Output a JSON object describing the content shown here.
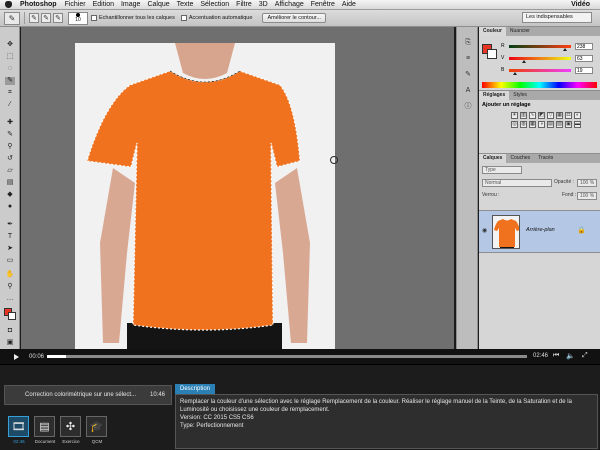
{
  "menubar": {
    "app_name": "Photoshop",
    "items": [
      "Fichier",
      "Edition",
      "Image",
      "Calque",
      "Texte",
      "Sélection",
      "Filtre",
      "3D",
      "Affichage",
      "Fenêtre",
      "Aide"
    ],
    "right_title": "Vidéo"
  },
  "options": {
    "brush_size": "10",
    "sample_all_layers": "Echantillonner tous les calques",
    "auto_enhance": "Accentuation automatique",
    "refine_edge_button": "Améliorer le contour...",
    "workspace": "Les indispensables"
  },
  "panels": {
    "color": {
      "tabs": [
        "Couleur",
        "Nuancier"
      ],
      "r_label": "R",
      "r_value": "238",
      "g_label": "V",
      "g_value": "63",
      "b_label": "B",
      "b_value": "19"
    },
    "adjustments": {
      "tabs": [
        "Réglages",
        "Styles"
      ],
      "title": "Ajouter un réglage"
    },
    "layers": {
      "tabs": [
        "Calques",
        "Couches",
        "Tracés"
      ],
      "filter": "Type",
      "blend_mode": "Normal",
      "opacity_label": "Opacité :",
      "opacity_value": "100 %",
      "lock_label": "Verrou :",
      "fill_label": "Fond :",
      "fill_value": "100 %",
      "layer_name": "Arrière-plan"
    }
  },
  "player": {
    "current_time": "00:06",
    "end_time": "02:46",
    "progress_fraction": 0.04
  },
  "chapter": {
    "title": "Correction colorimétrique sur une sélect...",
    "duration": "10:46"
  },
  "bottom_tabs": [
    {
      "label": "02:46",
      "icon": "film-icon",
      "active": true
    },
    {
      "label": "Document",
      "icon": "document-icon",
      "active": false
    },
    {
      "label": "Exercice",
      "icon": "puzzle-icon",
      "active": false
    },
    {
      "label": "QCM",
      "icon": "graduation-cap-icon",
      "active": false
    }
  ],
  "description": {
    "tab_label": "Description",
    "text": "Remplacer la couleur d'une sélection avec le réglage Remplacement de la couleur. Réaliser le réglage manuel de la Teinte, de la Saturation et de la Luminosité ou choisissez une couleur de remplacement.",
    "version": "Version: CC 2015 CS5 CS6",
    "type": "Type: Perfectionnement"
  },
  "colors": {
    "foreground": "#e93524",
    "shirt": "#f0721f",
    "accent": "#2a7fb4"
  }
}
